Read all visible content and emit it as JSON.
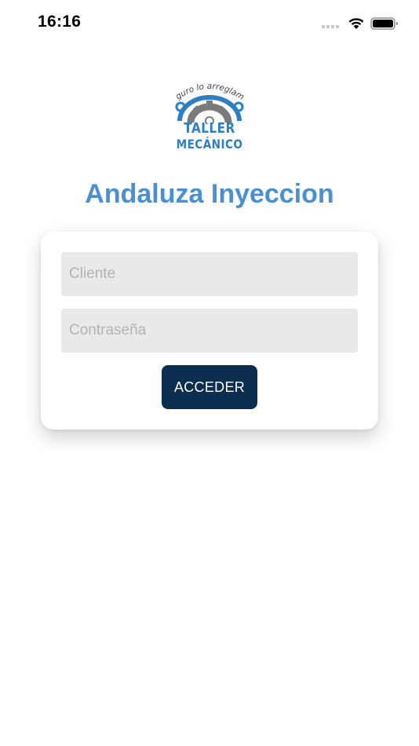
{
  "status_bar": {
    "time": "16:16"
  },
  "logo": {
    "tagline": "¡Seguro lo arreglamos!",
    "line1": "TALLER",
    "line2": "MECÁNICO",
    "brand_color": "#2d7fc1"
  },
  "app": {
    "title": "Andaluza Inyeccion",
    "title_color": "#4a8fd0"
  },
  "form": {
    "client_placeholder": "Cliente",
    "client_value": "",
    "password_placeholder": "Contraseña",
    "password_value": "",
    "submit_label": "ACCEDER",
    "button_color": "#0b2e4e",
    "field_color": "#e9e9e9"
  }
}
